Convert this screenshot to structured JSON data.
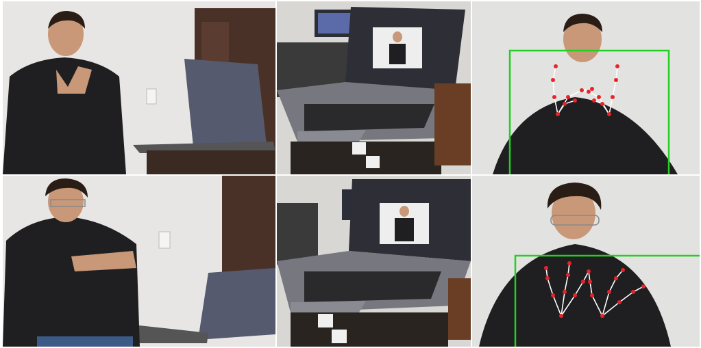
{
  "colors": {
    "wall": "#e6e4e2",
    "door": "#4a3128",
    "hoodie": "#1f1f21",
    "skin": "#c89878",
    "hair": "#2a1d16",
    "laptop_lid": "#5a5e73",
    "laptop_body": "#6e6f78",
    "bbox": "#22d022",
    "landmark": "#e8242a",
    "connection": "#ffffff"
  },
  "panels": [
    {
      "id": "signer-1-wide-view",
      "icon": "person-with-laptop"
    },
    {
      "id": "signer-1-laptop-screen-view",
      "icon": "laptop-camera-preview"
    },
    {
      "id": "signer-1-hand-landmarks",
      "icon": "hand-landmark-detection"
    },
    {
      "id": "signer-2-wide-view",
      "icon": "person-with-laptop"
    },
    {
      "id": "signer-2-laptop-screen-view",
      "icon": "laptop-camera-preview"
    },
    {
      "id": "signer-2-hand-landmarks",
      "icon": "hand-landmark-detection"
    }
  ]
}
